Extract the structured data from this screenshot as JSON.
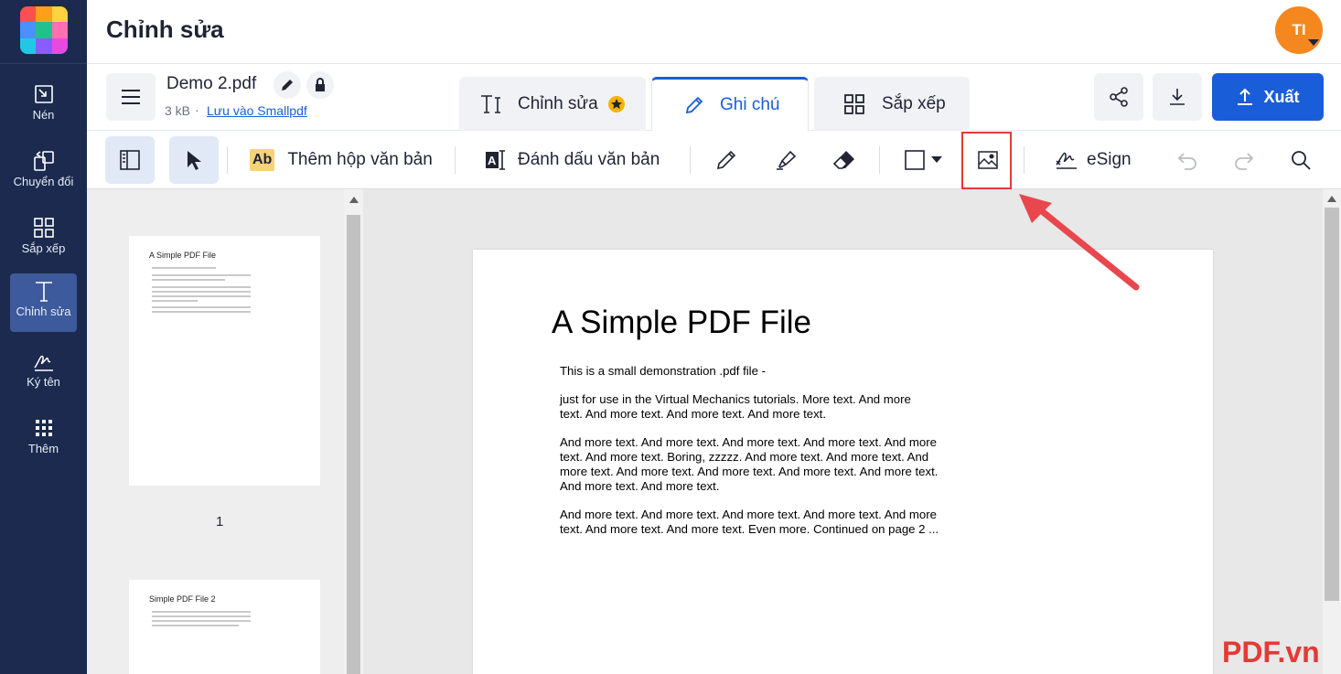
{
  "header": {
    "title": "Chỉnh sửa",
    "avatar_initials": "TI"
  },
  "rail": {
    "items": [
      {
        "label": "Nén",
        "icon": "compress-icon"
      },
      {
        "label": "Chuyển đổi",
        "icon": "convert-icon"
      },
      {
        "label": "Sắp xếp",
        "icon": "organize-grid-icon"
      },
      {
        "label": "Chỉnh sửa",
        "icon": "text-edit-icon",
        "active": true
      },
      {
        "label": "Ký tên",
        "icon": "signature-icon"
      },
      {
        "label": "Thêm",
        "icon": "more-grid-icon"
      }
    ]
  },
  "document": {
    "name": "Demo 2.pdf",
    "size": "3 kB",
    "separator": "·",
    "save_link": "Lưu vào Smallpdf"
  },
  "tabs": [
    {
      "label": "Chỉnh sửa",
      "icon": "text-cursor-icon",
      "badge": "star-badge-icon"
    },
    {
      "label": "Ghi chú",
      "icon": "pencil-icon",
      "active": true
    },
    {
      "label": "Sắp xếp",
      "icon": "grid-icon"
    }
  ],
  "actions": {
    "export_label": "Xuất",
    "share_icon": "share-icon",
    "download_icon": "download-icon"
  },
  "toolbar": {
    "add_textbox_label": "Thêm hộp văn bản",
    "add_textbox_icon_text": "Ab",
    "highlight_text_label": "Đánh dấu văn bản",
    "esign_label": "eSign"
  },
  "thumbnails": [
    {
      "title": "A Simple PDF File",
      "page_number": "1"
    },
    {
      "title": "Simple PDF File 2"
    }
  ],
  "page": {
    "title": "A Simple PDF File",
    "paragraphs": [
      [
        "This is a small demonstration .pdf file -"
      ],
      [
        "just for use in the Virtual Mechanics tutorials. More text. And more",
        "text. And more text. And more text. And more text."
      ],
      [
        "And more text. And more text. And more text. And more text. And more",
        "text. And more text. Boring, zzzzz. And more text. And more text. And",
        "more text. And more text. And more text. And more text. And more text.",
        "And more text. And more text."
      ],
      [
        "And more text. And more text. And more text. And more text. And more",
        "text. And more text. And more text. Even more. Continued on page 2 ..."
      ]
    ]
  },
  "watermark": "PDF.vn",
  "colors": {
    "rail_bg": "#1b2a4e",
    "accent": "#1a5dd8",
    "avatar": "#f5871f",
    "annotation_red": "#e53935"
  }
}
